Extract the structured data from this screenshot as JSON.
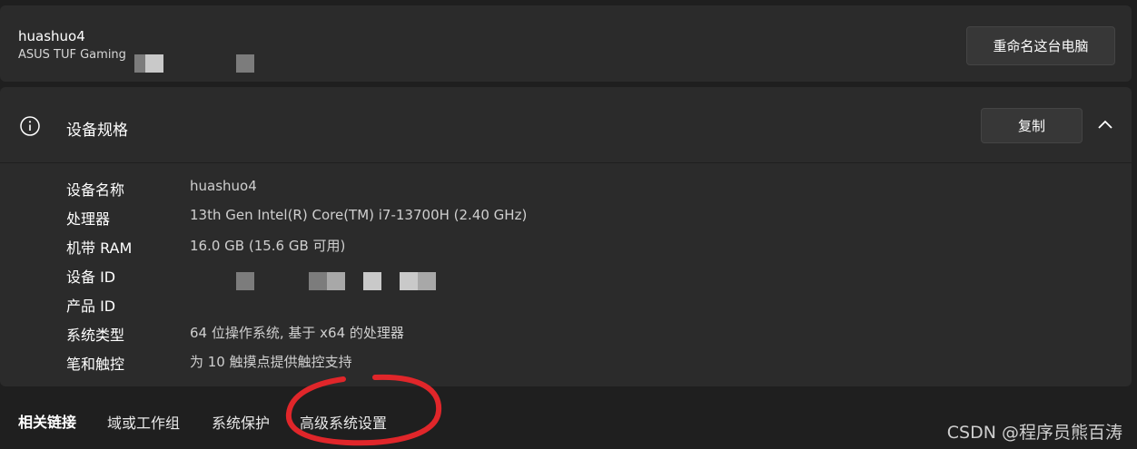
{
  "device": {
    "name": "huashuo4",
    "model": "ASUS TUF Gaming",
    "rename_button": "重命名这台电脑"
  },
  "specs": {
    "title": "设备规格",
    "copy_button": "复制",
    "rows": [
      {
        "label": "设备名称",
        "value": "huashuo4"
      },
      {
        "label": "处理器",
        "value": "13th Gen Intel(R) Core(TM) i7-13700H (2.40 GHz)"
      },
      {
        "label": "机带 RAM",
        "value": "16.0 GB (15.6 GB 可用)"
      },
      {
        "label": "设备 ID",
        "value": ""
      },
      {
        "label": "产品 ID",
        "value": ""
      },
      {
        "label": "系统类型",
        "value": "64 位操作系统, 基于 x64 的处理器"
      },
      {
        "label": "笔和触控",
        "value": "为 10 触摸点提供触控支持"
      }
    ]
  },
  "related": {
    "label": "相关链接",
    "links": [
      "域或工作组",
      "系统保护",
      "高级系统设置"
    ]
  },
  "watermark": "CSDN @程序员熊百涛",
  "icons": {
    "info": "info-icon",
    "chevron": "chevron-up-icon"
  },
  "colors": {
    "background": "#1f1f1f",
    "card": "#2b2b2b",
    "button": "#373737",
    "annotation_circle": "#e0262a"
  }
}
